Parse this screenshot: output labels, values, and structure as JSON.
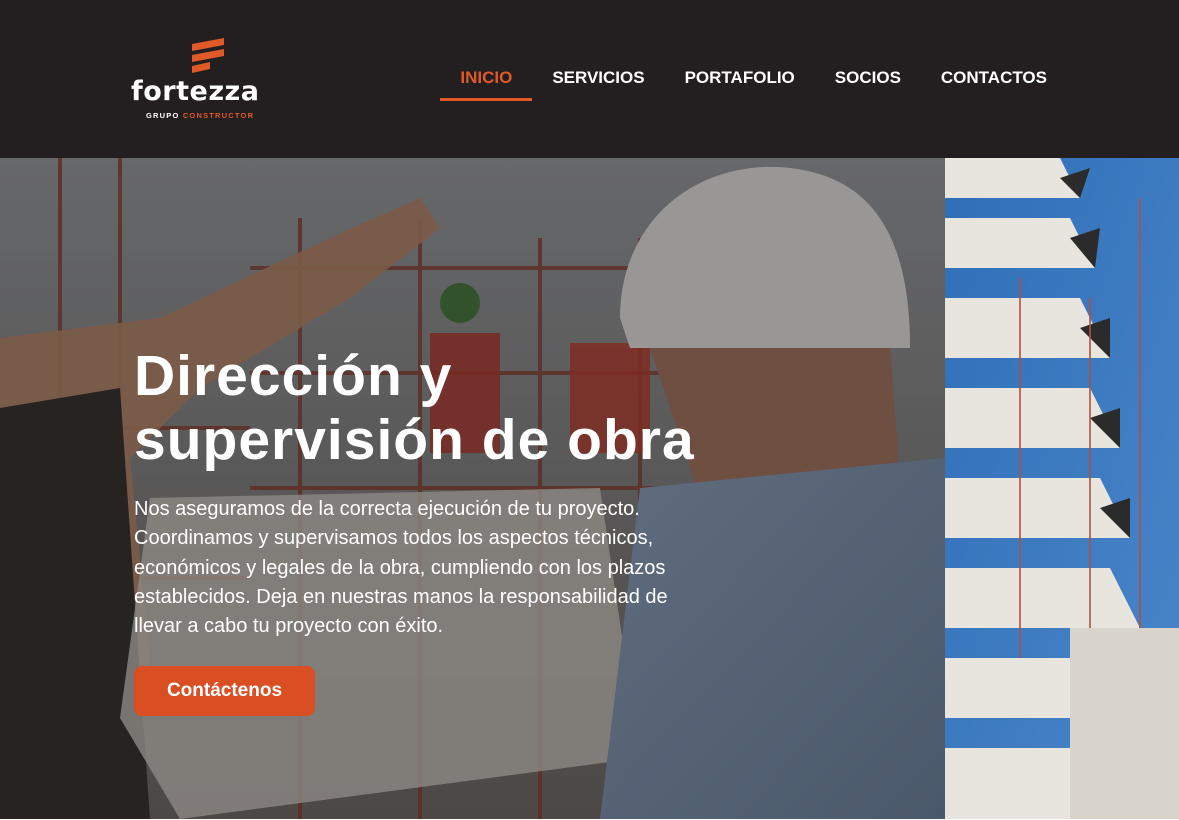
{
  "brand": {
    "name": "fortezza",
    "tagline_prefix": "GRUPO",
    "tagline_accent": "CONSTRUCTOR"
  },
  "nav": {
    "items": [
      {
        "label": "INICIO",
        "active": true
      },
      {
        "label": "SERVICIOS",
        "active": false
      },
      {
        "label": "PORTAFOLIO",
        "active": false
      },
      {
        "label": "SOCIOS",
        "active": false
      },
      {
        "label": "CONTACTOS",
        "active": false
      }
    ]
  },
  "hero": {
    "title": "Dirección y supervisión de obra",
    "description": "Nos aseguramos de la correcta ejecución de tu proyecto. Coordinamos y supervisamos todos los aspectos técnicos, económicos y legales de la obra, cumpliendo con los plazos establecidos. Deja en nuestras manos la responsabilidad de llevar a cabo tu proyecto con éxito.",
    "cta_label": "Contáctenos"
  },
  "colors": {
    "header_bg": "#231f20",
    "accent": "#e05a28",
    "button": "#d94e23",
    "text": "#ffffff"
  }
}
